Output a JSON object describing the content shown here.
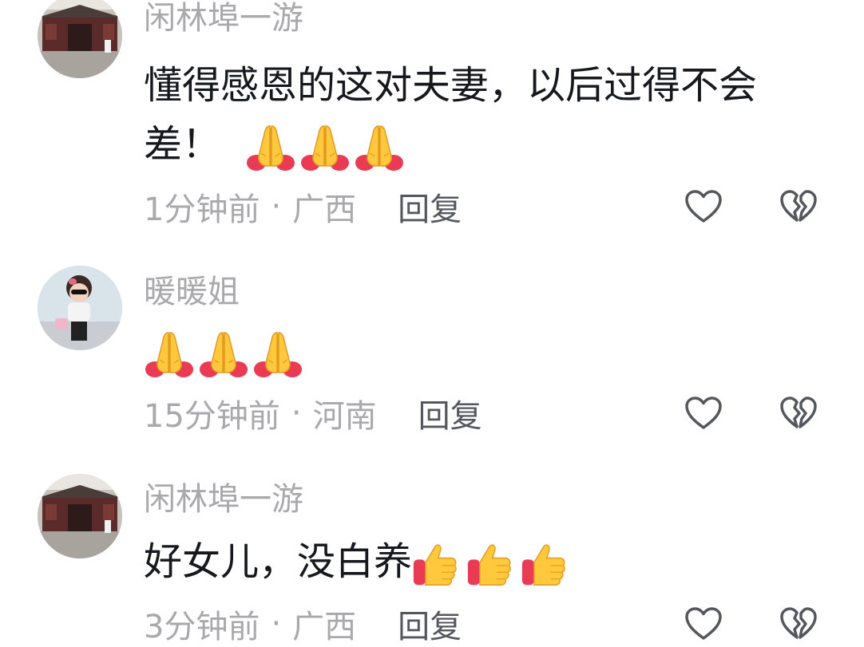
{
  "comments": [
    {
      "username": "闲林埠一游",
      "text": "懂得感恩的这对夫妻，以后过得不会差！",
      "emoji_icon": "folded-hands-emoji",
      "emoji_count": 3,
      "time": "1分钟前",
      "separator": "·",
      "location": "广西",
      "reply_label": "回复"
    },
    {
      "username": "暖暖姐",
      "text": "",
      "emoji_icon": "folded-hands-emoji",
      "emoji_count": 3,
      "time": "15分钟前",
      "separator": "·",
      "location": "河南",
      "reply_label": "回复"
    },
    {
      "username": "闲林埠一游",
      "text": "好女儿，没白养",
      "emoji_icon": "thumbs-up-emoji",
      "emoji_count": 3,
      "time": "3分钟前",
      "separator": "·",
      "location": "广西",
      "reply_label": "回复"
    }
  ],
  "icons": {
    "like": "heart-outline-icon",
    "dislike": "broken-heart-outline-icon"
  },
  "colors": {
    "username": "#a9a9ad",
    "text": "#16181d",
    "meta": "#a9a9ad",
    "reply": "#55575e",
    "icon_stroke": "#55575e"
  }
}
